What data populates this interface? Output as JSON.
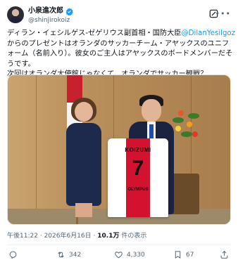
{
  "author": {
    "display_name": "小泉進次郎",
    "handle": "@shinjirokoiz",
    "verified": true,
    "verified_color": "#1d9bf0"
  },
  "header_icons": {
    "grok": "grok-icon",
    "more": "more-icon"
  },
  "tweet": {
    "text_before_mention": "ディラン・イェシルゲス-ゼゲリウス副首相・国防大臣",
    "mention": "@DilanYesilgoz",
    "text_after_mention": " からのプレゼントはオランダのサッカーチーム・アヤックスのユニフォーム（名前入り）。彼女のご主人はアヤックスのボードメンバーだそうです。",
    "text_line2": "次回はオランダ大使館じゃなくて、オランダでサッカー観戦？"
  },
  "photo": {
    "jersey_name": "KOIZUMI",
    "jersey_number": "7",
    "jersey_sponsor": "OLYMPUS"
  },
  "meta": {
    "time": "午後11:22",
    "separator": "·",
    "date": "2026年6月16日",
    "views_count": "10.1万",
    "views_label": "件の表示"
  },
  "actions": {
    "reply_icon": "reply-icon",
    "retweets": "342",
    "likes": "4,330",
    "bookmarks": "67"
  },
  "colors": {
    "text": "#0f1419",
    "secondary": "#536471",
    "link": "#1d9bf0"
  }
}
